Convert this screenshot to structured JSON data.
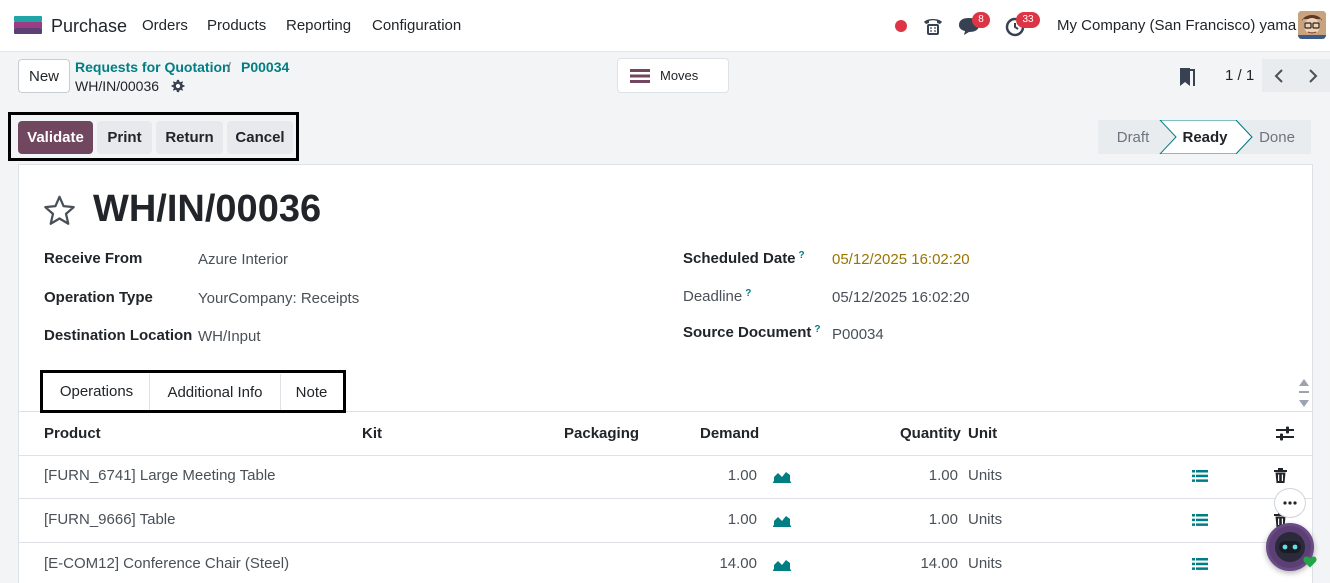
{
  "app": {
    "name": "Purchase"
  },
  "menu": [
    "Orders",
    "Products",
    "Reporting",
    "Configuration"
  ],
  "systray": {
    "messages_badge": "8",
    "activities_badge": "33",
    "company": "My Company (San Francisco) yama"
  },
  "control": {
    "new_label": "New",
    "breadcrumb": [
      "Requests for Quotation",
      "P00034"
    ],
    "breadcrumb_sep": "/",
    "current": "WH/IN/00036",
    "moves_label": "Moves",
    "pager": "1 / 1"
  },
  "actions": [
    "Validate",
    "Print",
    "Return",
    "Cancel"
  ],
  "status": {
    "steps": [
      "Draft",
      "Ready",
      "Done"
    ],
    "active": "Ready"
  },
  "record": {
    "title": "WH/IN/00036",
    "fields_left": [
      {
        "label": "Receive From",
        "value": "Azure Interior"
      },
      {
        "label": "Operation Type",
        "value": "YourCompany: Receipts"
      },
      {
        "label": "Destination Location",
        "value": "WH/Input"
      }
    ],
    "fields_right": [
      {
        "label": "Scheduled Date",
        "help": "?",
        "value": "05/12/2025 16:02:20"
      },
      {
        "label": "Deadline",
        "help": "?",
        "value": "05/12/2025 16:02:20"
      },
      {
        "label": "Source Document",
        "help": "?",
        "value": "P00034"
      }
    ]
  },
  "tabs": [
    "Operations",
    "Additional Info",
    "Note"
  ],
  "table": {
    "headers": [
      "Product",
      "Kit",
      "Packaging",
      "Demand",
      "Quantity",
      "Unit"
    ],
    "rows": [
      {
        "product": "[FURN_6741] Large Meeting Table",
        "demand": "1.00",
        "quantity": "1.00",
        "unit": "Units"
      },
      {
        "product": "[FURN_9666] Table",
        "demand": "1.00",
        "quantity": "1.00",
        "unit": "Units"
      },
      {
        "product": "[E-COM12] Conference Chair (Steel)",
        "demand": "14.00",
        "quantity": "14.00",
        "unit": "Units"
      }
    ]
  },
  "colors": {
    "primary": "#71465f",
    "link": "#017e84",
    "warning_date": "#9a7500",
    "badge": "#dc3545"
  }
}
